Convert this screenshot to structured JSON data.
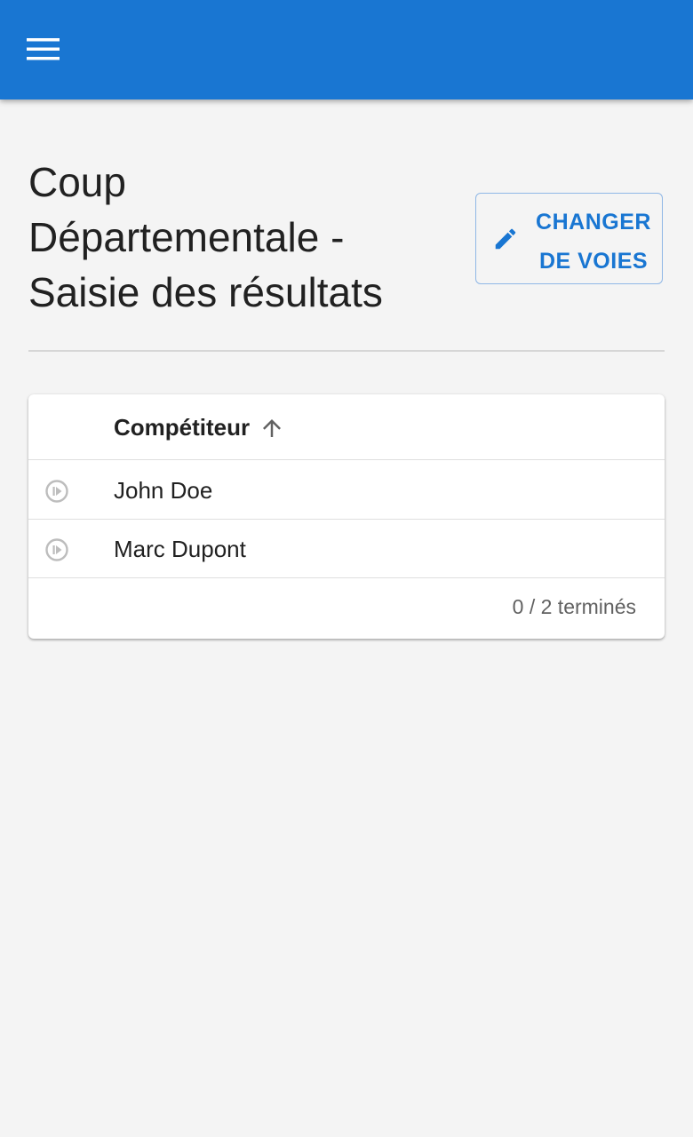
{
  "appbar": {
    "menu_icon": "menu-icon",
    "color": "#1976d2"
  },
  "page": {
    "title_lines": [
      "Coup",
      "Départementale -",
      "Saisie des résultats"
    ]
  },
  "actions": {
    "change_lanes": {
      "icon": "pencil-icon",
      "label_lines": [
        "CHANGER",
        "DE VOIES"
      ],
      "color": "#1976d2"
    }
  },
  "table": {
    "columns": [
      {
        "label": "Compétiteur",
        "sort": "ascending",
        "sort_icon": "arrow-up-icon"
      }
    ],
    "rows": [
      {
        "status_icon": "play-circle-icon",
        "name": "John Doe"
      },
      {
        "status_icon": "play-circle-icon",
        "name": "Marc Dupont"
      }
    ],
    "footer": "0 / 2 terminés"
  }
}
